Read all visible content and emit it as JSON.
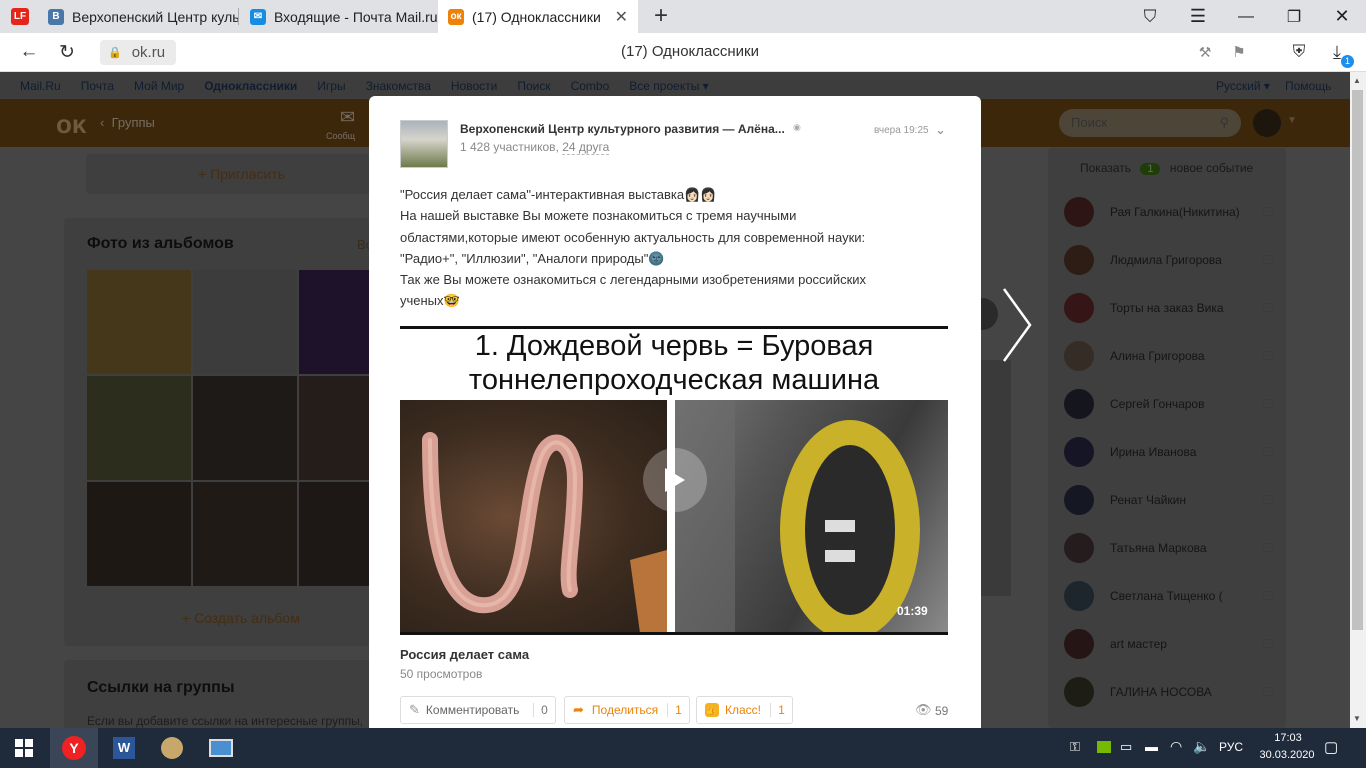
{
  "browser": {
    "tabs": [
      {
        "label": "Верхопенский Центр культ",
        "icon": "vk-icon",
        "color": "#4a76a8"
      },
      {
        "label": "Входящие - Почта Mail.ru",
        "icon": "mail-icon",
        "color": "#168de2"
      },
      {
        "label": "(17) Одноклассники",
        "icon": "ok-icon",
        "color": "#ee8208"
      }
    ],
    "lf_badge": "LF",
    "url": "ok.ru",
    "page_title": "(17) Одноклассники",
    "downloads_badge": "1"
  },
  "mailbar": {
    "items": [
      "Mail.Ru",
      "Почта",
      "Мой Мир",
      "Одноклассники",
      "Игры",
      "Знакомства",
      "Новости",
      "Поиск",
      "Combo",
      "Все проекты ▾"
    ],
    "language": "Русский ▾",
    "help": "Помощь"
  },
  "okheader": {
    "back_label": "Группы",
    "search_placeholder": "Поиск",
    "messages_label": "Сообщ"
  },
  "left": {
    "invite": "+ Пригласить",
    "photos_title": "Фото из альбомов",
    "photos_more": "Во",
    "create_album": "+ Создать альбом",
    "links_title": "Ссылки на группы",
    "links_text": "Если вы добавите ссылки на интересные группы,"
  },
  "right": {
    "show_label": "Показать",
    "show_count": "1",
    "show_suffix": "новое событие",
    "friends": [
      "Рая Галкина(Никитина)",
      "Людмила Григорова",
      "Торты на заказ Вика",
      "Алина Григорова",
      "Сергей Гончаров",
      "Ирина Иванова",
      "Ренат Чайкин",
      "Татьяна Маркова",
      "Светлана Тищенко (",
      "art мастер",
      "ГАЛИНА НОСОВА"
    ]
  },
  "post": {
    "group_name": "Верхопенский Центр культурного развития — Алёна...",
    "members": "1 428 участников,",
    "friends": "24 друга",
    "time": "вчера 19:25",
    "text_lines": [
      "\"Россия делает сама\"-интерактивная выставка👩🏻👩🏻",
      "На нашей выставке Вы можете познакомиться с тремя научными",
      "областями,которые имеют особенную актуальность для современной науки:",
      "\"Радио+\", \"Иллюзии\", \"Аналоги природы\"🌚",
      "Так же Вы можете ознакомиться с легендарными изобретениями российских",
      "ученых🤓"
    ],
    "video_caption_line1": "1. Дождевой червь = Буровая",
    "video_caption_line2": "тоннелепроходческая машина",
    "duration": "01:39",
    "video_title": "Россия делает сама",
    "views": "50 просмотров",
    "comment_label": "Комментировать",
    "comment_count": "0",
    "share_label": "Поделиться",
    "share_count": "1",
    "like_label": "Класс!",
    "like_count": "1",
    "eye_count": "59"
  },
  "taskbar": {
    "lang": "РУС",
    "time": "17:03",
    "date": "30.03.2020"
  }
}
